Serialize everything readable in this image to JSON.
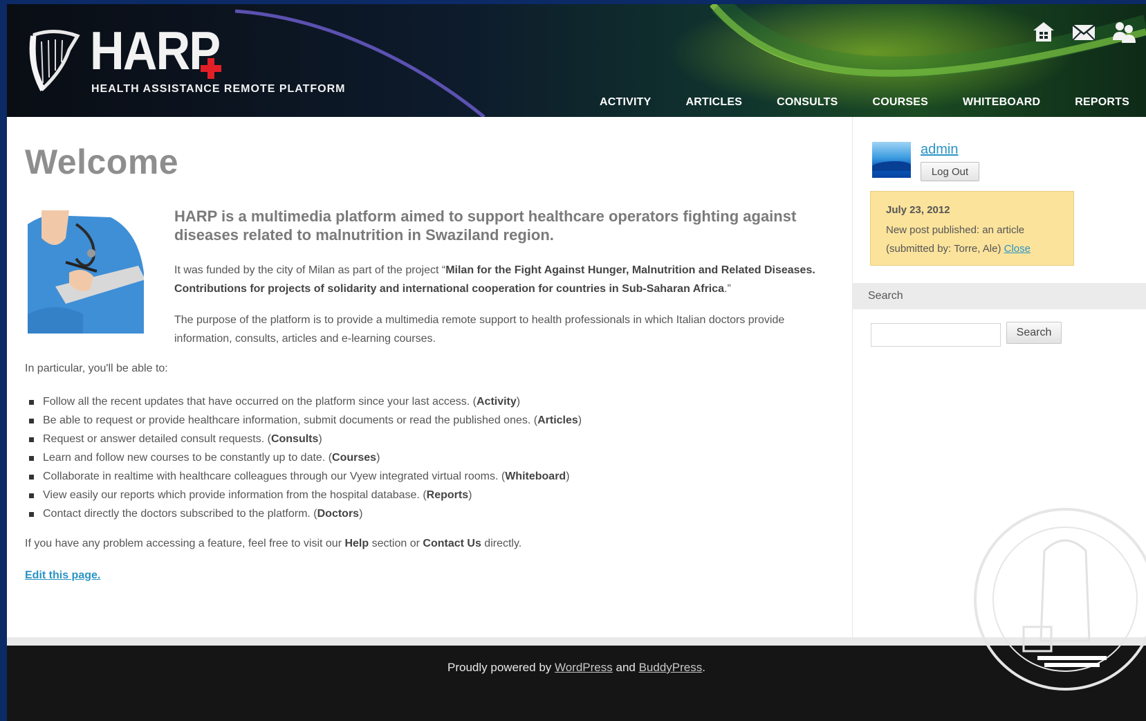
{
  "header": {
    "logo_text": "HARP",
    "logo_subtitle": "HEALTH ASSISTANCE REMOTE PLATFORM",
    "top_icons": [
      "home-icon",
      "mail-icon",
      "users-icon"
    ],
    "nav": [
      "ACTIVITY",
      "ARTICLES",
      "CONSULTS",
      "COURSES",
      "WHITEBOARD",
      "REPORTS"
    ]
  },
  "main": {
    "title": "Welcome",
    "lead": "HARP is a multimedia platform aimed to support healthcare operators fighting against diseases related to malnutrition in Swaziland region.",
    "para1_prefix": "It was funded by the city of Milan as part of the project “",
    "para1_bold": "Milan for the Fight Against Hunger, Malnutrition and Related Diseases. Contributions for projects of solidarity and international cooperation for countries in Sub-Saharan Africa",
    "para1_suffix": ".”",
    "para2": "The purpose of the platform is to provide a multimedia remote support to health professionals in which Italian doctors provide information, consults, articles and e-learning courses.",
    "intro": "In particular, you'll be able to:",
    "features": [
      {
        "text": "Follow all the recent updates that have occurred on the platform since your last access. (",
        "bold": "Activity",
        "end": ")"
      },
      {
        "text": "Be able to request or provide healthcare information, submit documents or read the published ones. (",
        "bold": "Articles",
        "end": ")"
      },
      {
        "text": "Request or answer detailed consult requests. (",
        "bold": "Consults",
        "end": ")"
      },
      {
        "text": "Learn and follow new courses to be constantly up to date. (",
        "bold": "Courses",
        "end": ")"
      },
      {
        "text": "Collaborate in realtime with healthcare colleagues through our Vyew integrated virtual rooms. (",
        "bold": "Whiteboard",
        "end": ")"
      },
      {
        "text": "View easily our reports which provide information from the hospital database. (",
        "bold": "Reports",
        "end": ")"
      },
      {
        "text": "Contact directly the doctors subscribed to the platform. (",
        "bold": "Doctors",
        "end": ")"
      }
    ],
    "outro_1": "If you have any problem accessing a feature, feel free to visit our ",
    "outro_help": "Help",
    "outro_2": " section or ",
    "outro_contact": "Contact Us",
    "outro_3": " directly.",
    "edit_link": "Edit this page."
  },
  "sidebar": {
    "username": "admin",
    "logout_label": "Log Out",
    "notice_date": "July 23, 2012",
    "notice_text": "New post published: an article (submitted by: Torre, Ale) ",
    "notice_close": "Close",
    "search_heading": "Search",
    "search_value": "",
    "search_button": "Search"
  },
  "footer": {
    "prefix": "Proudly powered by ",
    "wordpress": "WordPress",
    "and": " and ",
    "buddypress": "BuddyPress",
    "suffix": "."
  },
  "colors": {
    "link": "#2a93c4",
    "notice_bg": "#fbe39c",
    "footer_bg": "#151515",
    "title_gray": "#8e8e8e",
    "logo_cross": "#e21f26",
    "outer_border": "#0b2a66"
  }
}
